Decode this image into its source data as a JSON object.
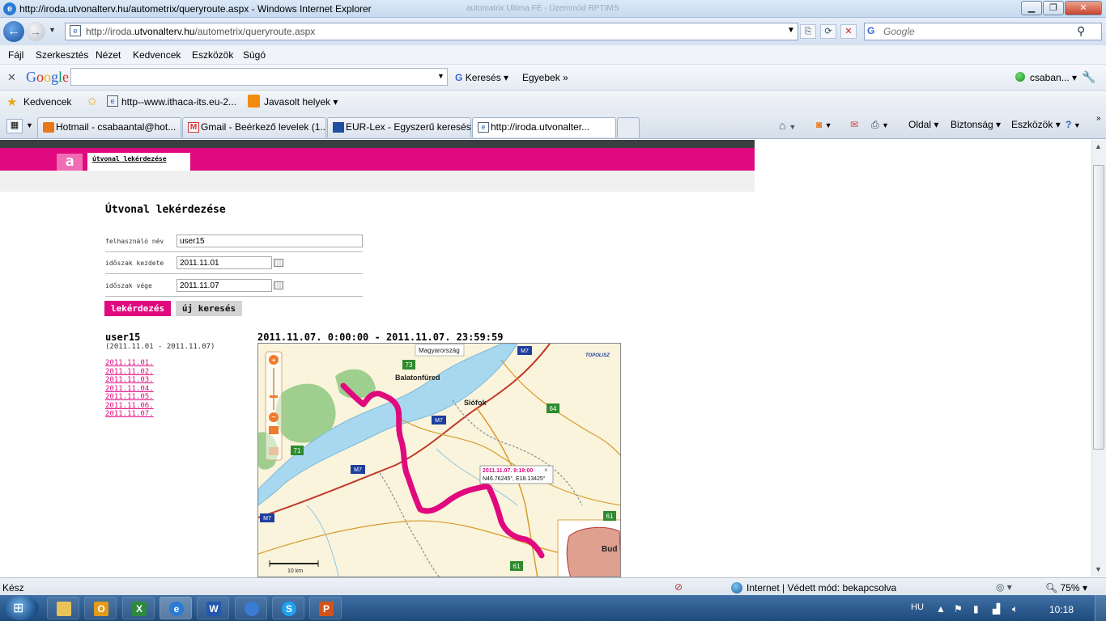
{
  "window": {
    "title": "http://iroda.utvonalterv.hu/autometrix/queryroute.aspx - Windows Internet Explorer",
    "background_window_title": "automatrix Ultima FÉ - Üzemmód RPTIMS"
  },
  "address_bar": {
    "url_prefix": "http://iroda.",
    "url_domain": "utvonalterv.hu",
    "url_path": "/autometrix/queryroute.aspx"
  },
  "search_box": {
    "placeholder": "Google"
  },
  "menu": [
    "Fájl",
    "Szerkesztés",
    "Nézet",
    "Kedvencek",
    "Eszközök",
    "Súgó"
  ],
  "google_toolbar": {
    "logo": "Google",
    "search_label": "Keresés",
    "more_label": "Egyebek",
    "user_label": "csaban..."
  },
  "favorites_bar": {
    "label": "Kedvencek",
    "links": [
      "http--www.ithaca-its.eu-2...",
      "Javasolt helyek"
    ]
  },
  "tabs": [
    {
      "label": "Hotmail - csabaantal@hot...",
      "icon": "hotmail-icon"
    },
    {
      "label": "Gmail - Beérkező levelek (1...",
      "icon": "gmail-icon"
    },
    {
      "label": "EUR-Lex - Egyszerű keresés",
      "icon": "eurlex-icon"
    },
    {
      "label": "http://iroda.utvonalter...",
      "icon": "ie-page-icon"
    }
  ],
  "command_bar": [
    "Oldal",
    "Biztonság",
    "Eszközök"
  ],
  "page": {
    "header_tab": "útvonal lekérdezése",
    "logo_letter": "a",
    "title": "Útvonal lekérdezése",
    "form": {
      "username_label": "felhasználó név",
      "username_value": "user15",
      "start_label": "időszak kezdete",
      "start_value": "2011.11.01",
      "end_label": "időszak vége",
      "end_value": "2011.11.07"
    },
    "buttons": {
      "query": "lekérdezés",
      "new_search": "új keresés"
    },
    "result": {
      "user": "user15",
      "range": "(2011.11.01 - 2011.11.07)",
      "dates": [
        "2011.11.01.",
        "2011.11.02.",
        "2011.11.03.",
        "2011.11.04.",
        "2011.11.05.",
        "2011.11.06.",
        "2011.11.07."
      ],
      "route_title": "2011.11.07. 0:00:00 - 2011.11.07. 23:59:59"
    },
    "map": {
      "region_label": "Magyarország",
      "brand": "TOPOLISZ",
      "places": [
        "Balatonfüred",
        "Siófok",
        "Bud"
      ],
      "roads": [
        "73",
        "M7",
        "64",
        "71",
        "M7",
        "M7",
        "61",
        "61",
        "M7"
      ],
      "popup_time": "2011.11.07. 9:19:00",
      "popup_coords": "N46.76245°, E18.13425°",
      "scale": "10 km",
      "route_color": "#e0097e",
      "lake_color": "#a7d8f0"
    }
  },
  "status_bar": {
    "text": "Kész",
    "zone": "Internet | Védett mód: bekapcsolva",
    "zoom": "75%"
  },
  "taskbar": {
    "language": "HU",
    "clock": "10:18"
  }
}
